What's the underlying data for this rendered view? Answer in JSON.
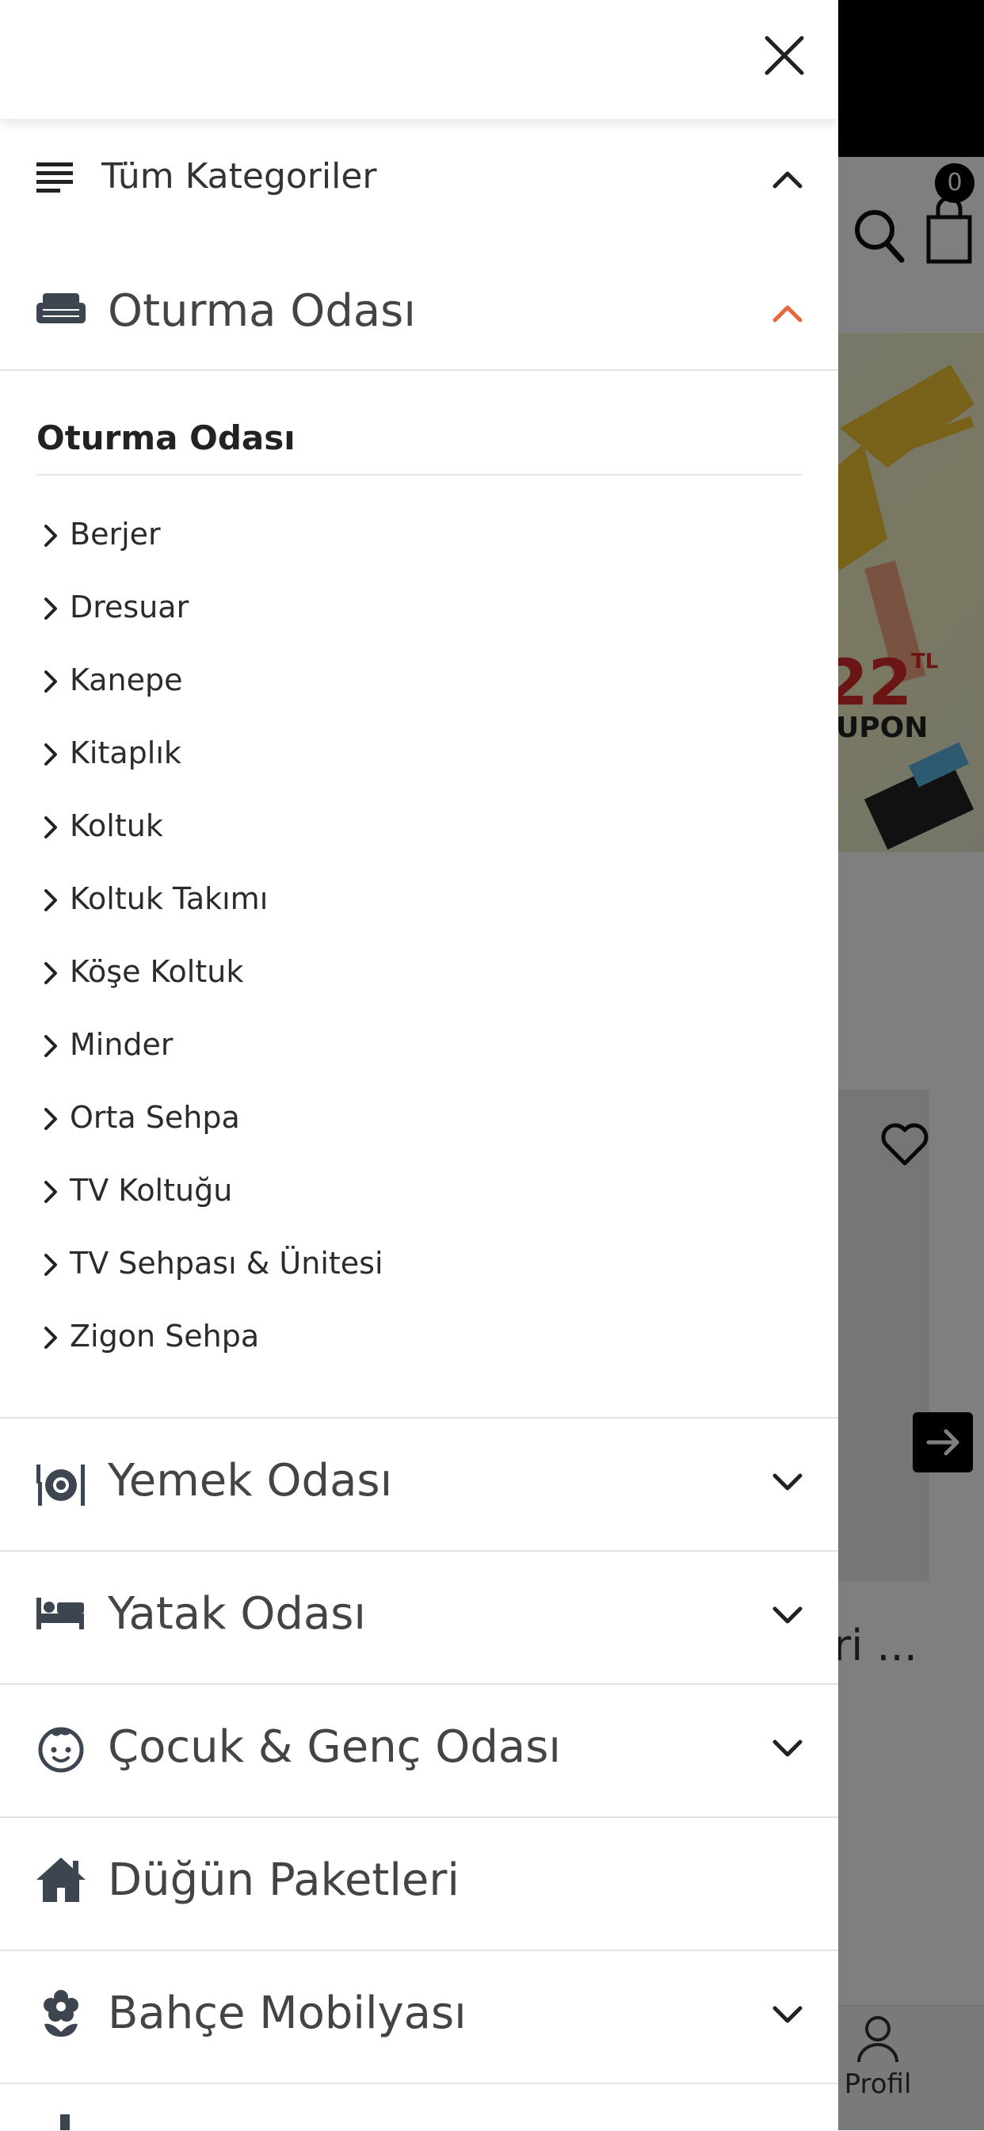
{
  "background": {
    "cart_count": "0",
    "banner_value": "22",
    "banner_unit": "TL",
    "banner_sub": "UPON",
    "product_title_fragment": "ri ...",
    "bottom_nav_profile_label": "Profil"
  },
  "drawer": {
    "all_categories_label": "Tüm Kategoriler",
    "categories": [
      {
        "label": "Oturma Odası",
        "icon": "sofa-icon",
        "expanded": true
      },
      {
        "label": "Yemek Odası",
        "icon": "dining-icon",
        "expanded": false
      },
      {
        "label": "Yatak Odası",
        "icon": "bed-icon",
        "expanded": false
      },
      {
        "label": "Çocuk & Genç Odası",
        "icon": "child-face-icon",
        "expanded": false
      },
      {
        "label": "Düğün Paketleri",
        "icon": "home-icon",
        "expanded": false
      },
      {
        "label": "Bahçe Mobilyası",
        "icon": "flower-icon",
        "expanded": false
      }
    ],
    "submenu": {
      "title": "Oturma Odası",
      "items": [
        "Berjer",
        "Dresuar",
        "Kanepe",
        "Kitaplık",
        "Koltuk",
        "Koltuk Takımı",
        "Köşe Koltuk",
        "Minder",
        "Orta Sehpa",
        "TV Koltuğu",
        "TV Sehpası & Ünitesi",
        "Zigon Sehpa"
      ]
    }
  },
  "colors": {
    "accent": "#e8663d",
    "text": "#444444",
    "divider": "#e3e3e3"
  }
}
